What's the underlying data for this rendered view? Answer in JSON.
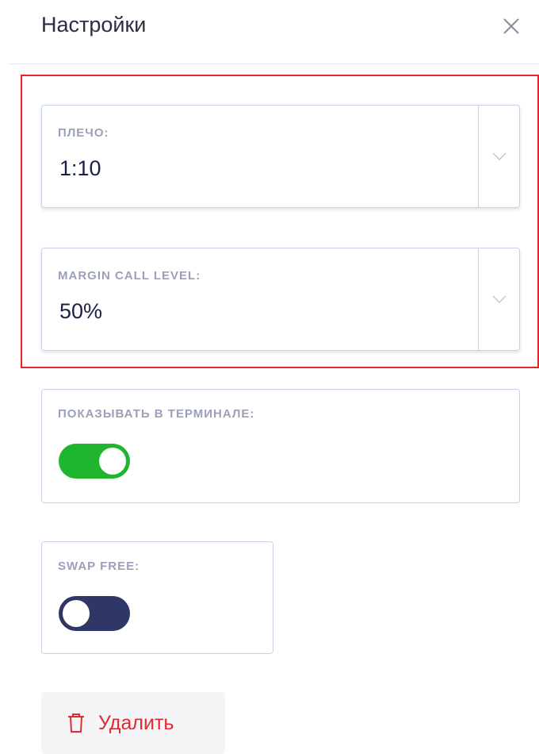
{
  "header": {
    "title": "Настройки",
    "close_icon": "close-icon"
  },
  "leverage": {
    "label": "ПЛЕЧО:",
    "value": "1:10",
    "icon": "chevron-down-icon"
  },
  "margin_call": {
    "label": "MARGIN CALL LEVEL:",
    "value": "50%",
    "icon": "chevron-down-icon"
  },
  "show_in_terminal": {
    "label": "ПОКАЗЫВАТЬ В ТЕРМИНАЛЕ:",
    "enabled": true
  },
  "swap_free": {
    "label": "SWAP FREE:",
    "enabled": false
  },
  "delete_button": {
    "label": "Удалить",
    "icon": "trash-icon"
  },
  "colors": {
    "highlight": "#e6242b",
    "toggle_on": "#1fb52e",
    "toggle_off": "#2f3766",
    "danger": "#e02a32"
  }
}
